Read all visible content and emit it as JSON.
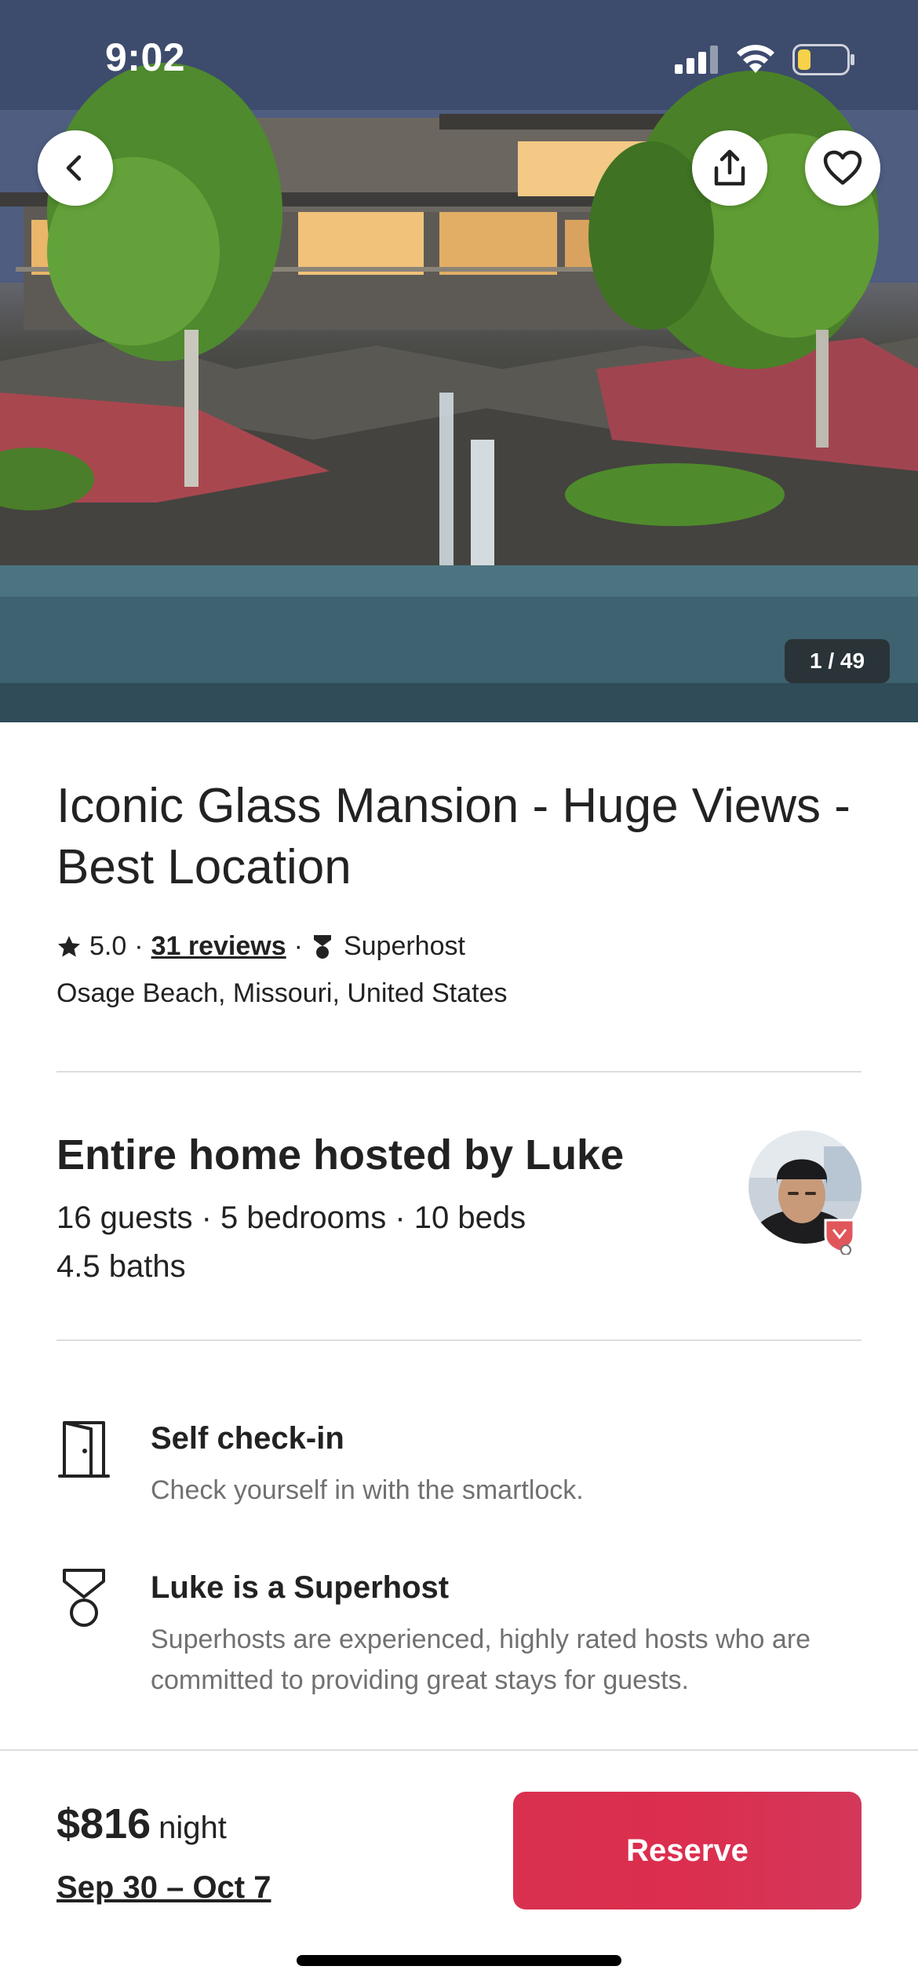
{
  "status_bar": {
    "time": "9:02"
  },
  "hero": {
    "photo_counter": "1 / 49",
    "icons": {
      "back": "chevron-left-icon",
      "share": "share-icon",
      "save": "heart-icon"
    }
  },
  "listing": {
    "title": "Iconic Glass Mansion - Huge Views - Best Location",
    "rating": "5.0",
    "reviews": "31 reviews",
    "superhost_label": "Superhost",
    "location": "Osage Beach, Missouri, United States"
  },
  "host": {
    "title": "Entire home hosted by Luke",
    "details_line1": "16 guests · 5 bedrooms · 10 beds",
    "details_line2": "4.5 baths"
  },
  "features": [
    {
      "icon": "door-icon",
      "title": "Self check-in",
      "description": "Check yourself in with the smartlock."
    },
    {
      "icon": "medal-icon",
      "title": "Luke is a Superhost",
      "description": "Superhosts are experienced, highly rated hosts who are committed to providing great stays for guests."
    }
  ],
  "footer": {
    "price": "$816",
    "price_unit": "night",
    "dates": "Sep 30 – Oct 7",
    "reserve_label": "Reserve"
  },
  "colors": {
    "accent": "#DA3155",
    "text": "#222222",
    "secondary_text": "#717171",
    "divider": "#DDDDDD"
  }
}
